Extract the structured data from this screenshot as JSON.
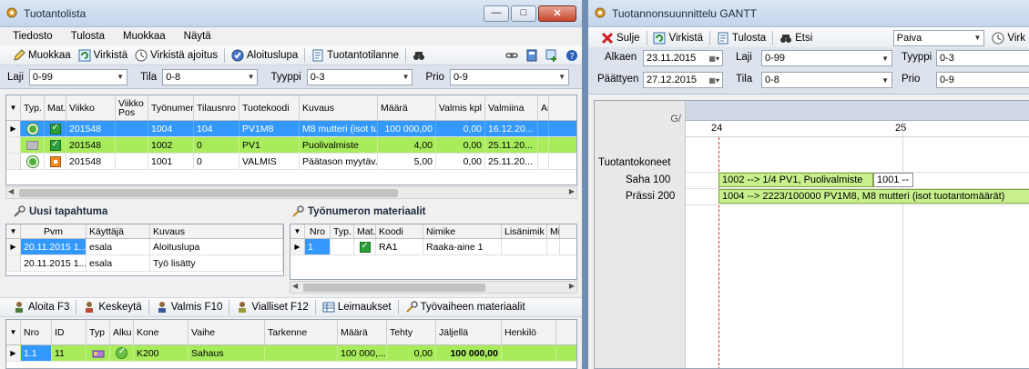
{
  "win1": {
    "title": "Tuotantolista",
    "controls": {
      "min": "—",
      "max": "□",
      "close": "✕"
    },
    "menu": [
      "Tiedosto",
      "Tulosta",
      "Muokkaa",
      "Näytä"
    ],
    "toolbar": {
      "muokkaa": "Muokkaa",
      "virkista": "Virkistä",
      "virkista_ajoitus": "Virkistä ajoitus",
      "aloituslupa": "Aloituslupa",
      "tuotantotilanne": "Tuotantotilanne"
    },
    "filters": {
      "laji_label": "Laji",
      "laji_value": "0-99",
      "tila_label": "Tila",
      "tila_value": "0-8",
      "tyyppi_label": "Tyyppi",
      "tyyppi_value": "0-3",
      "prio_label": "Prio",
      "prio_value": "0-9"
    },
    "list": {
      "columns": [
        "Typ.",
        "Mat.",
        "Viikko",
        "Viikko Pos",
        "Työnumero",
        "Tilausnro",
        "Tuotekoodi",
        "Kuvaus",
        "Määrä",
        "Valmis kpl",
        "Valmiina",
        "As"
      ],
      "rows": [
        {
          "viikko": "201548",
          "tyonumero": "1004",
          "tilausnro": "104",
          "tuotekoodi": "PV1M8",
          "kuvaus": "M8 mutteri (isot tu...",
          "maara": "100 000,00",
          "valmis": "0,00",
          "valmiina": "16.12.20..."
        },
        {
          "viikko": "201548",
          "tyonumero": "1002",
          "tilausnro": "0",
          "tuotekoodi": "PV1",
          "kuvaus": "Puolivalmiste",
          "maara": "4,00",
          "valmis": "0,00",
          "valmiina": "25.11.20..."
        },
        {
          "viikko": "201548",
          "tyonumero": "1001",
          "tilausnro": "0",
          "tuotekoodi": "VALMIS",
          "kuvaus": "Päätason myytäv...",
          "maara": "5,00",
          "valmis": "0,00",
          "valmiina": "25.11.20..."
        }
      ]
    },
    "events": {
      "title": "Uusi tapahtuma",
      "columns": [
        "Pvm",
        "Käyttäjä",
        "Kuvaus"
      ],
      "rows": [
        {
          "pvm": "20.11.2015 1...",
          "kayttaja": "esala",
          "kuvaus": "Aloituslupa"
        },
        {
          "pvm": "20.11.2015 1...",
          "kayttaja": "esala",
          "kuvaus": "Työ lisätty"
        }
      ]
    },
    "materials": {
      "title": "Työnumeron materiaalit",
      "columns": [
        "Nro",
        "Typ.",
        "Mat.",
        "Koodi",
        "Nimike",
        "Lisänimik",
        "Mit"
      ],
      "rows": [
        {
          "nro": "1",
          "koodi": "RA1",
          "nimike": "Raaka-aine 1"
        }
      ]
    },
    "phase_toolbar": {
      "aloita": "Aloita F3",
      "keskeyta": "Keskeytä",
      "valmis": "Valmis F10",
      "vialliset": "Vialliset F12",
      "leimaukset": "Leimaukset",
      "materiaalit": "Työvaiheen materiaalit"
    },
    "phases": {
      "columns": [
        "Nro",
        "ID",
        "Typ",
        "Alku",
        "Kone",
        "Vaihe",
        "Tarkenne",
        "Määrä",
        "Tehty",
        "Jäljellä",
        "Henkilö"
      ],
      "rows": [
        {
          "nro": "1.1",
          "id": "11",
          "kone": "K200",
          "vaihe": "Sahaus",
          "tarkenne": "",
          "maara": "100 000,...",
          "tehty": "0,00",
          "jaljella": "100 000,00",
          "henkilo": ""
        }
      ]
    }
  },
  "win2": {
    "title": "Tuotannonsuunnittelu GANTT",
    "toolbar": {
      "sulje": "Sulje",
      "virkista": "Virkistä",
      "tulosta": "Tulosta",
      "etsi": "Etsi",
      "scale": "Paiva",
      "virk": "Virk"
    },
    "filters": {
      "alkaen_label": "Alkaen",
      "alkaen_value": "23.11.2015",
      "paattyen_label": "Päättyen",
      "paattyen_value": "27.12.2015",
      "laji_label": "Laji",
      "laji_value": "0-99",
      "tila_label": "Tila",
      "tila_value": "0-8",
      "tyyppi_label": "Tyyppi",
      "tyyppi_value": "0-3",
      "prio_label": "Prio",
      "prio_value": "0-9"
    },
    "gantt": {
      "corner": "G/",
      "weeks": [
        "24",
        "25"
      ],
      "group_label": "Tuotantokoneet",
      "machines": [
        "Saha 100",
        "Prässi 200"
      ],
      "bars": {
        "saha_a": "1002 --> 1/4 PV1, Puolivalmiste",
        "saha_b": "1001 --",
        "prassi": "1004 --> 2223/100000 PV1M8, M8 mutteri (isot tuotantomäärät)"
      }
    }
  }
}
